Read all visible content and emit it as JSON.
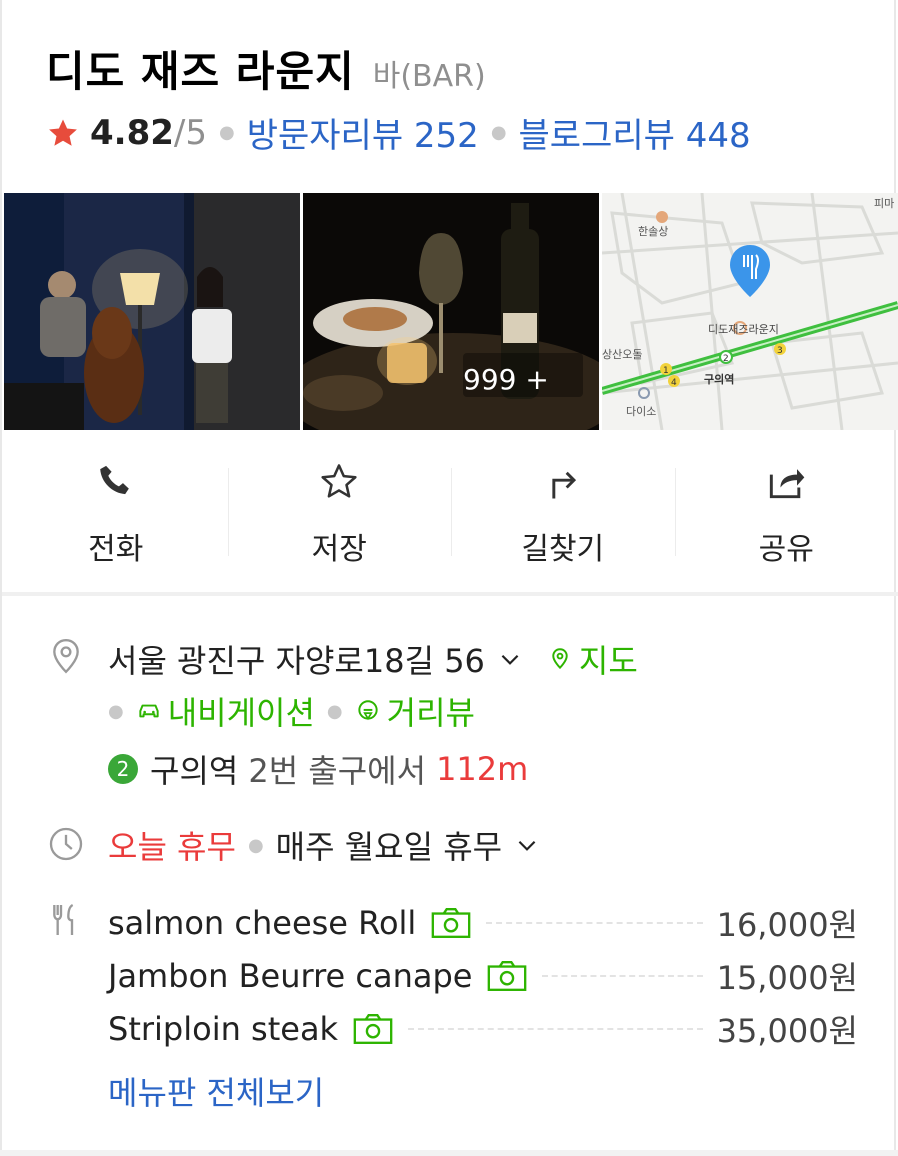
{
  "place": {
    "name": "디도 재즈 라운지",
    "category": "바(BAR)",
    "rating": "4.82",
    "rating_max": "/5",
    "visitor_reviews": "방문자리뷰 252",
    "blog_reviews": "블로그리뷰 448"
  },
  "photos": {
    "count_badge": "999 +",
    "map_labels": {
      "place": "디도재즈라운지",
      "station": "구의역",
      "poi1": "한솔상",
      "poi2": "피마",
      "poi3": "상산오돌",
      "poi4": "다이소",
      "exit_1": "1",
      "exit_2": "2",
      "exit_3": "3",
      "exit_4": "4"
    }
  },
  "actions": [
    {
      "label": "전화",
      "icon": "phone-icon"
    },
    {
      "label": "저장",
      "icon": "star-icon"
    },
    {
      "label": "길찾기",
      "icon": "directions-icon"
    },
    {
      "label": "공유",
      "icon": "share-icon"
    }
  ],
  "info": {
    "address": "서울 광진구 자양로18길 56",
    "map_link": "지도",
    "navigation_link": "내비게이션",
    "streetview_link": "거리뷰",
    "subway_line": "2",
    "subway_station": "구의역",
    "subway_exit": "2번 출구에서",
    "subway_distance": "112m",
    "closed_today": "오늘 휴무",
    "closed_detail": "매주 월요일 휴무"
  },
  "menu": {
    "items": [
      {
        "name": "salmon cheese Roll",
        "price": "16,000원"
      },
      {
        "name": "Jambon Beurre canape",
        "price": "15,000원"
      },
      {
        "name": "Striploin steak",
        "price": "35,000원"
      }
    ],
    "more_link": "메뉴판 전체보기"
  },
  "colors": {
    "accent_blue": "#2b65c6",
    "accent_green": "#2db400",
    "accent_red": "#ea3b3b",
    "star_red": "#e74c3c"
  }
}
